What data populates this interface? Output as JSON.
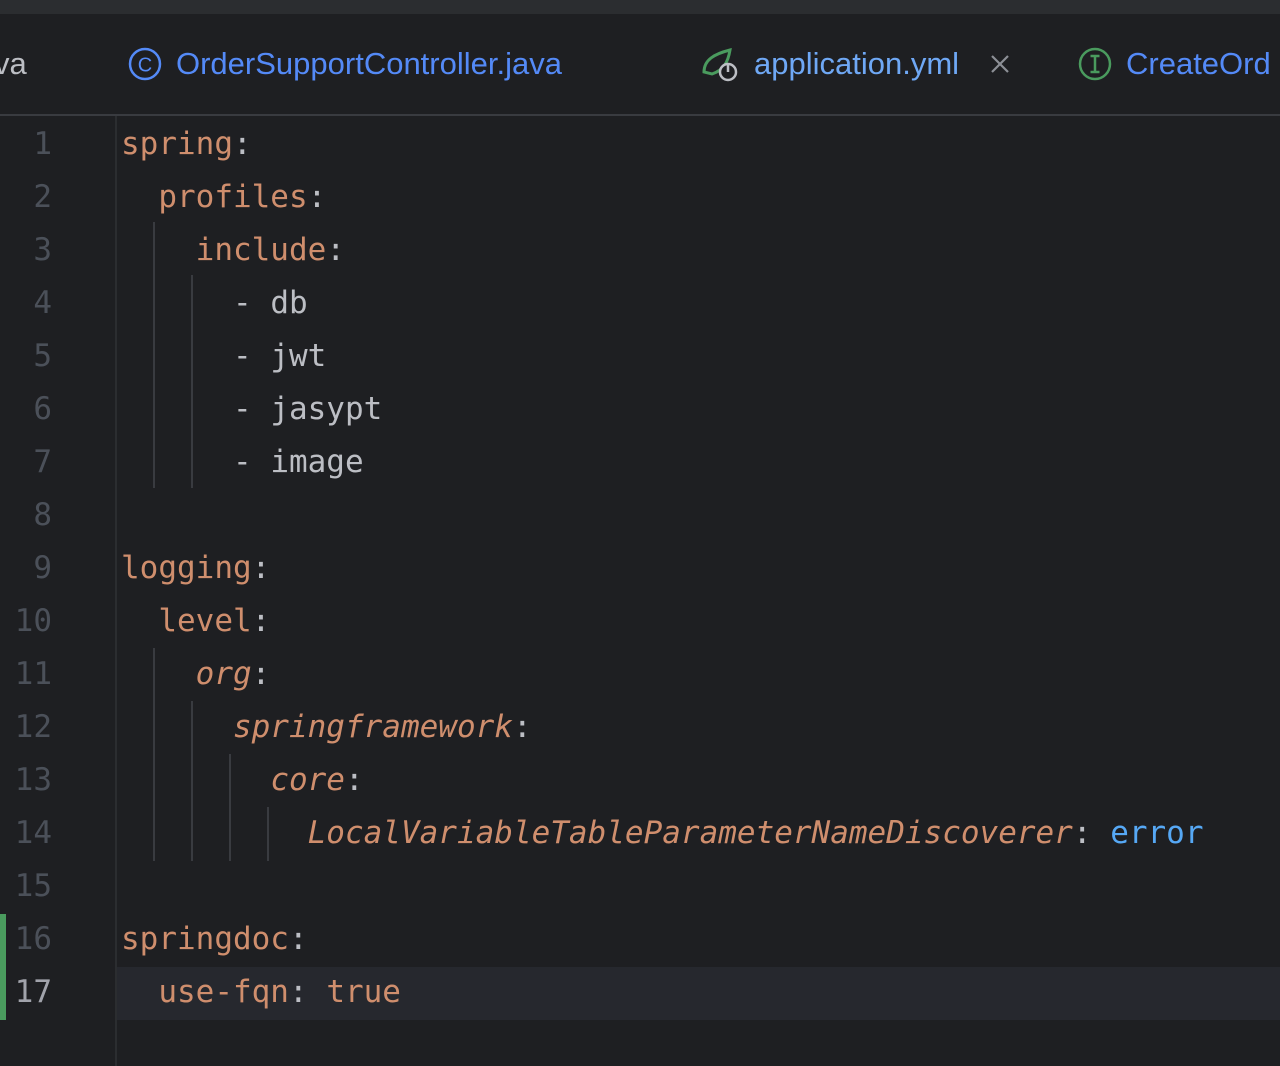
{
  "tabs": [
    {
      "label": "va",
      "icon": "none",
      "active": false
    },
    {
      "label": "OrderSupportController.java",
      "icon": "class-icon",
      "active": false
    },
    {
      "label": "application.yml",
      "icon": "spring-boot-config-icon",
      "active": true
    },
    {
      "label": "CreateOrd",
      "icon": "interface-icon",
      "active": false
    }
  ],
  "editor": {
    "current_line": 17,
    "changed_lines": [
      16,
      17
    ],
    "lines": [
      {
        "n": "1",
        "parts": [
          {
            "t": "spring",
            "c": "key"
          },
          {
            "t": ":",
            "c": "punct"
          }
        ]
      },
      {
        "n": "2",
        "parts": [
          {
            "t": "  "
          },
          {
            "t": "profiles",
            "c": "key"
          },
          {
            "t": ":",
            "c": "punct"
          }
        ]
      },
      {
        "n": "3",
        "parts": [
          {
            "t": "    "
          },
          {
            "t": "include",
            "c": "key"
          },
          {
            "t": ":",
            "c": "punct"
          }
        ]
      },
      {
        "n": "4",
        "parts": [
          {
            "t": "      - "
          },
          {
            "t": "db",
            "c": "val"
          }
        ]
      },
      {
        "n": "5",
        "parts": [
          {
            "t": "      - "
          },
          {
            "t": "jwt",
            "c": "val"
          }
        ]
      },
      {
        "n": "6",
        "parts": [
          {
            "t": "      - "
          },
          {
            "t": "jasypt",
            "c": "val"
          }
        ]
      },
      {
        "n": "7",
        "parts": [
          {
            "t": "      - "
          },
          {
            "t": "image",
            "c": "val"
          }
        ]
      },
      {
        "n": "8",
        "parts": []
      },
      {
        "n": "9",
        "parts": [
          {
            "t": "logging",
            "c": "key"
          },
          {
            "t": ":",
            "c": "punct"
          }
        ]
      },
      {
        "n": "10",
        "parts": [
          {
            "t": "  "
          },
          {
            "t": "level",
            "c": "key"
          },
          {
            "t": ":",
            "c": "punct"
          }
        ]
      },
      {
        "n": "11",
        "parts": [
          {
            "t": "    "
          },
          {
            "t": "org",
            "c": "key ital"
          },
          {
            "t": ":",
            "c": "punct"
          }
        ]
      },
      {
        "n": "12",
        "parts": [
          {
            "t": "      "
          },
          {
            "t": "springframework",
            "c": "key ital"
          },
          {
            "t": ":",
            "c": "punct"
          }
        ]
      },
      {
        "n": "13",
        "parts": [
          {
            "t": "        "
          },
          {
            "t": "core",
            "c": "key ital"
          },
          {
            "t": ":",
            "c": "punct"
          }
        ]
      },
      {
        "n": "14",
        "parts": [
          {
            "t": "          "
          },
          {
            "t": "LocalVariableTableParameterNameDiscoverer",
            "c": "key ital"
          },
          {
            "t": ": ",
            "c": "punct"
          },
          {
            "t": "error",
            "c": "val-blue"
          }
        ]
      },
      {
        "n": "15",
        "parts": []
      },
      {
        "n": "16",
        "parts": [
          {
            "t": "springdoc",
            "c": "key"
          },
          {
            "t": ":",
            "c": "punct"
          }
        ]
      },
      {
        "n": "17",
        "parts": [
          {
            "t": "  "
          },
          {
            "t": "use-fqn",
            "c": "key"
          },
          {
            "t": ": ",
            "c": "punct"
          },
          {
            "t": "true",
            "c": "val-bool"
          }
        ]
      }
    ]
  },
  "colors": {
    "background": "#1e1f22",
    "key": "#cf8e6d",
    "text": "#bcbec4",
    "blue_value": "#56a8f5",
    "tab_link": "#548af7",
    "active_underline": "#3574f0",
    "change_marker": "#4a9b5e"
  }
}
